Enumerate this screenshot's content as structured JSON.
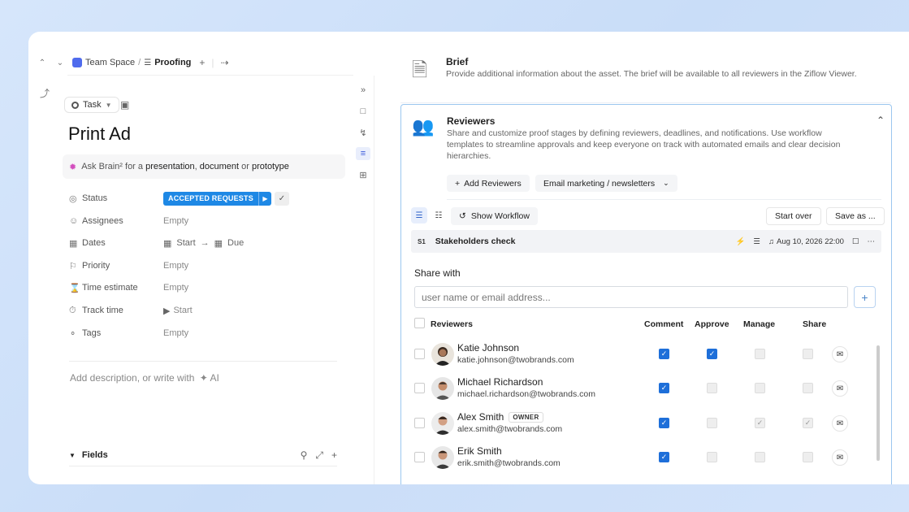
{
  "breadcrumb": {
    "space": "Team Space",
    "list": "Proofing"
  },
  "task": {
    "type_label": "Task",
    "title": "Print Ad",
    "ask_prefix": "Ask Brain² for a",
    "ask_presentation": "presentation",
    "ask_comma": ",",
    "ask_document": "document",
    "ask_or": "or",
    "ask_prototype": "prototype"
  },
  "properties": {
    "status_label": "Status",
    "status_value": "ACCEPTED REQUESTS",
    "assignees_label": "Assignees",
    "assignees_value": "Empty",
    "dates_label": "Dates",
    "dates_start": "Start",
    "dates_due": "Due",
    "priority_label": "Priority",
    "priority_value": "Empty",
    "time_estimate_label": "Time estimate",
    "time_estimate_value": "Empty",
    "track_time_label": "Track time",
    "track_time_value": "Start",
    "tags_label": "Tags",
    "tags_value": "Empty"
  },
  "description_placeholder": "Add description, or write with",
  "ai_label": "AI",
  "fields_label": "Fields",
  "brief": {
    "title": "Brief",
    "description": "Provide additional information about the asset. The brief will be available to all reviewers in the Ziflow Viewer."
  },
  "reviewers": {
    "title": "Reviewers",
    "description": "Share and customize proof stages by defining reviewers, deadlines, and notifications. Use workflow templates to streamline approvals and keep everyone on track with automated emails and clear decision hierarchies.",
    "add_button": "Add Reviewers",
    "template_select": "Email marketing / newsletters",
    "show_workflow": "Show Workflow",
    "start_over": "Start over",
    "save_as": "Save as ...",
    "stage_tag": "S1",
    "stage_name": "Stakeholders check",
    "stage_deadline": "Aug 10, 2026 22:00",
    "share_with": "Share with",
    "share_placeholder": "user name or email address...",
    "col_reviewers": "Reviewers",
    "col_comment": "Comment",
    "col_approve": "Approve",
    "col_manage": "Manage",
    "col_share": "Share",
    "owner_badge": "OWNER",
    "people": [
      {
        "name": "Katie Johnson",
        "email": "katie.johnson@twobrands.com"
      },
      {
        "name": "Michael Richardson",
        "email": "michael.richardson@twobrands.com"
      },
      {
        "name": "Alex Smith",
        "email": "alex.smith@twobrands.com"
      },
      {
        "name": "Erik Smith",
        "email": "erik.smith@twobrands.com"
      }
    ]
  },
  "colors": {
    "accent": "#1e88e5",
    "checkbox": "#1e6fd9",
    "card_border": "#9cc7ef"
  }
}
